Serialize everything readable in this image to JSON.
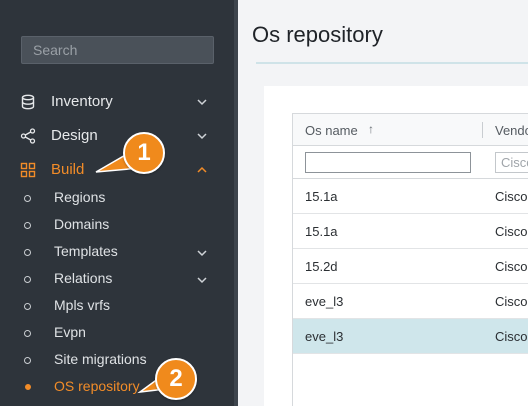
{
  "sidebar": {
    "search_placeholder": "Search",
    "items": [
      {
        "label": "Inventory",
        "icon": "database-icon"
      },
      {
        "label": "Design",
        "icon": "share-nodes-icon"
      },
      {
        "label": "Build",
        "icon": "grid-icon"
      }
    ],
    "build_subitems": [
      {
        "label": "Regions"
      },
      {
        "label": "Domains"
      },
      {
        "label": "Templates"
      },
      {
        "label": "Relations"
      },
      {
        "label": "Mpls vrfs"
      },
      {
        "label": "Evpn"
      },
      {
        "label": "Site migrations"
      },
      {
        "label": "OS repository"
      }
    ]
  },
  "callouts": [
    "1",
    "2"
  ],
  "main": {
    "title": "Os repository",
    "table": {
      "columns": [
        "Os name",
        "Vendor"
      ],
      "sort_indicator": "↑",
      "vendor_filter_placeholder": "Cisco",
      "rows": [
        {
          "os_name": "15.1a",
          "vendor": "Cisco"
        },
        {
          "os_name": "15.1a",
          "vendor": "Cisco"
        },
        {
          "os_name": "15.2d",
          "vendor": "Cisco"
        },
        {
          "os_name": "eve_l3",
          "vendor": "Cisco"
        },
        {
          "os_name": "eve_l3",
          "vendor": "Cisco"
        }
      ]
    }
  },
  "colors": {
    "sidebar_bg": "#2e343b",
    "accent": "#f28c28",
    "selected_row": "#cfe6eb"
  }
}
